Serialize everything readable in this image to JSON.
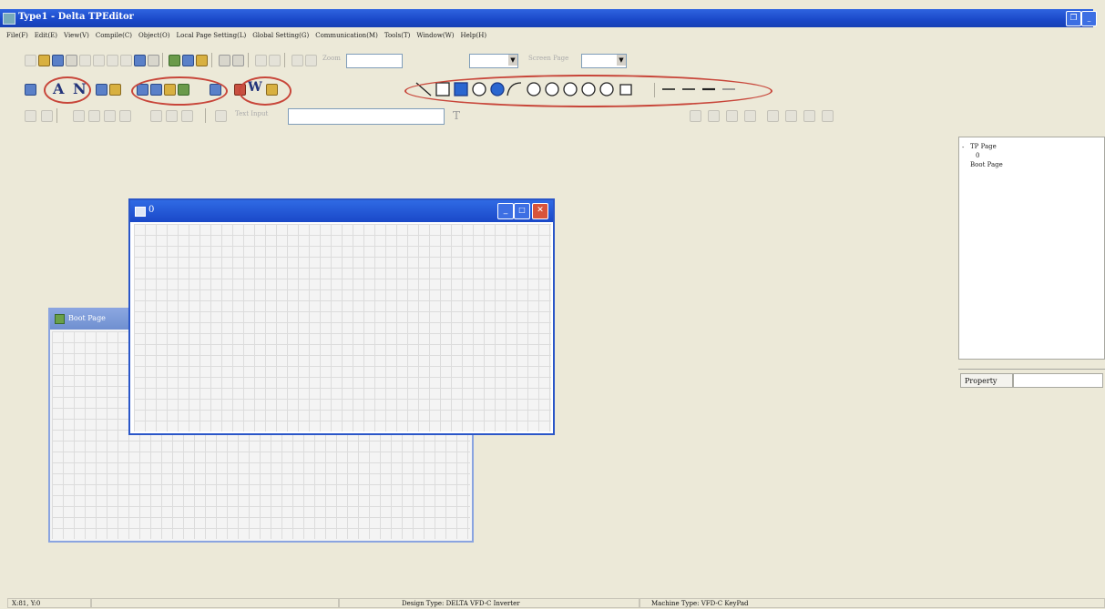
{
  "window": {
    "title": "Type1 - Delta TPEditor"
  },
  "menu": {
    "items": [
      "File(F)",
      "Edit(E)",
      "View(V)",
      "Compile(C)",
      "Object(O)",
      "Local Page Setting(L)",
      "Global Setting(G)",
      "Communication(M)",
      "Tools(T)",
      "Window(W)",
      "Help(H)"
    ]
  },
  "toolbar1": {
    "zoom_label": "Zoom",
    "page_label": "Screen Page"
  },
  "toolbar2": {
    "text_letter_a": "A",
    "text_letter_n": "N",
    "word_letter_w": "W"
  },
  "toolbar3": {
    "text_input_label": "Text Input",
    "text_input_value": "",
    "text_button": "T"
  },
  "children": {
    "front": {
      "title": "0"
    },
    "back": {
      "title": "Boot Page"
    }
  },
  "tree": {
    "root": "TP Page",
    "child": "0",
    "boot": "Boot Page"
  },
  "property": {
    "label": "Property"
  },
  "status": {
    "coords": "X:81, Y:0",
    "design_type": "Design Type: DELTA VFD-C Inverter",
    "machine_type": "Machine Type: VFD-C KeyPad"
  },
  "colors": {
    "accent": "#1a48c8",
    "annotation": "#c8463a",
    "workspace": "#ece9d8"
  }
}
